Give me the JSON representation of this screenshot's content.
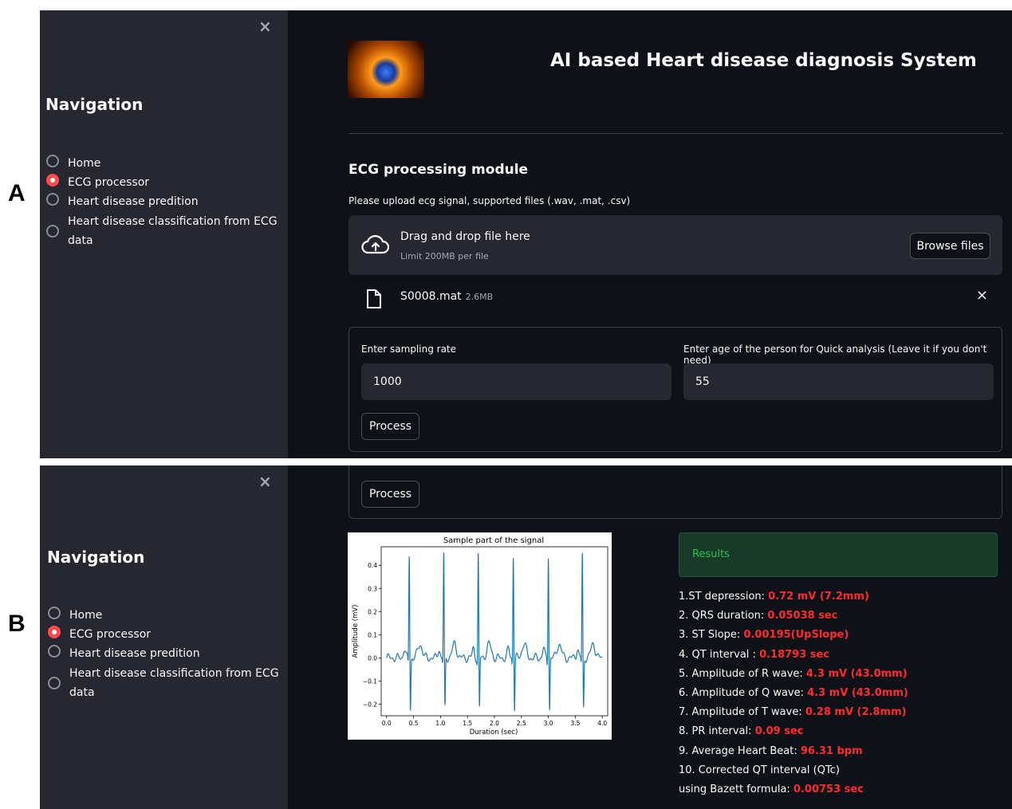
{
  "panels": {
    "a": "A",
    "b": "B"
  },
  "sidebar": {
    "close": "×",
    "title": "Navigation",
    "items": [
      {
        "label": "Home",
        "selected": false
      },
      {
        "label": "ECG processor",
        "selected": true
      },
      {
        "label": "Heart disease predition",
        "selected": false
      },
      {
        "label": "Heart disease classification from ECG",
        "label2": "data",
        "selected": false
      }
    ]
  },
  "header": {
    "title": "AI based Heart disease diagnosis System"
  },
  "ecg": {
    "section_title": "ECG processing module",
    "upload_hint": "Please upload ecg signal, supported files (.wav, .mat, .csv)",
    "dropzone": {
      "title": "Drag and drop file here",
      "limit": "Limit 200MB per file",
      "browse": "Browse files"
    },
    "file": {
      "name": "S0008.mat",
      "size": "2.6MB",
      "remove": "×"
    },
    "form": {
      "sampling_label": "Enter sampling rate",
      "sampling_value": "1000",
      "age_label": "Enter age of the person for Quick analysis (Leave it if you don't need)",
      "age_value": "55",
      "process": "Process"
    }
  },
  "chart_data": {
    "type": "line",
    "title": "Sample part of the signal",
    "xlabel": "Duration (sec)",
    "ylabel": "Amplitude (mV)",
    "xlim": [
      -0.1,
      4.1
    ],
    "ylim": [
      -0.25,
      0.48
    ],
    "xticks": [
      "0.0",
      "0.5",
      "1.0",
      "1.5",
      "2.0",
      "2.5",
      "3.0",
      "3.5",
      "4.0"
    ],
    "yticks": [
      "0.4",
      "0.3",
      "0.2",
      "0.1",
      "0.0",
      "-0.1",
      "-0.2"
    ],
    "r_peaks_sec": [
      0.42,
      1.06,
      1.7,
      2.35,
      3.0,
      3.63
    ],
    "r_amplitude": 0.45,
    "s_amplitude": -0.23,
    "baseline": 0.0,
    "grid": false,
    "color": "#1f77b4"
  },
  "results": {
    "label": "Results",
    "lines": [
      {
        "text": "1.ST depression: ",
        "value": "0.72 mV (7.2mm)"
      },
      {
        "text": "2. QRS duration: ",
        "value": "0.05038 sec"
      },
      {
        "text": "3. ST Slope: ",
        "value": "0.00195(UpSlope)"
      },
      {
        "text": "4. QT interval : ",
        "value": "0.18793 sec"
      },
      {
        "text": "5. Amplitude of R wave: ",
        "value": "4.3 mV (43.0mm)"
      },
      {
        "text": "6. Amplitude of Q wave: ",
        "value": "4.3 mV (43.0mm)"
      },
      {
        "text": "7. Amplitude of T wave: ",
        "value": "0.28 mV (2.8mm)"
      },
      {
        "text": "8. PR interval: ",
        "value": "0.09 sec"
      },
      {
        "text": "9. Average Heart Beat: ",
        "value": "96.31 bpm"
      },
      {
        "text": "10. Corrected QT interval (QTc)",
        "value": ""
      },
      {
        "text": "using Bazett formula: ",
        "value": "0.00753 sec"
      }
    ]
  }
}
